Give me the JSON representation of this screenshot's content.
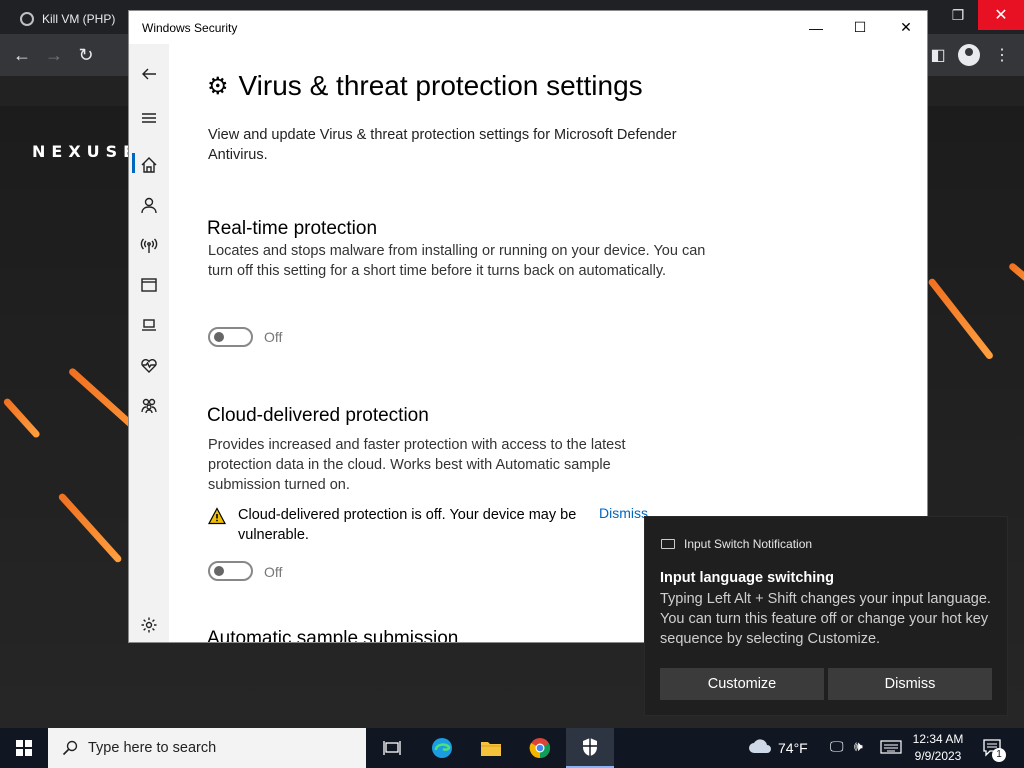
{
  "browser": {
    "tab_title": "Kill VM (PHP)",
    "close_glyph": "✕",
    "restore_glyph": "❐"
  },
  "background": {
    "logo_text": "NEXUSE"
  },
  "window": {
    "title": "Windows Security",
    "minimize_glyph": "—",
    "maximize_glyph": "☐",
    "close_glyph": "✕"
  },
  "page": {
    "title": "Virus & threat protection settings",
    "intro": "View and update Virus & threat protection settings for Microsoft Defender Antivirus.",
    "sections": [
      {
        "heading": "Real-time protection",
        "description": "Locates and stops malware from installing or running on your device. You can turn off this setting for a short time before it turns back on automatically.",
        "toggle_state": "Off"
      },
      {
        "heading": "Cloud-delivered protection",
        "description": "Provides increased and faster protection with access to the latest protection data in the cloud. Works best with Automatic sample submission turned on.",
        "warning": "Cloud-delivered protection is off. Your device may be vulnerable.",
        "warning_link": "Dismiss",
        "toggle_state": "Off"
      },
      {
        "heading": "Automatic sample submission"
      }
    ]
  },
  "notification": {
    "app_name": "Input Switch Notification",
    "title": "Input language switching",
    "body": "Typing Left Alt + Shift changes your input language. You can turn this feature off or change your hot key sequence by selecting Customize.",
    "buttons": [
      "Customize",
      "Dismiss"
    ]
  },
  "taskbar": {
    "search_placeholder": "Type here to search",
    "weather": "74°F",
    "time": "12:34 AM",
    "date": "9/9/2023",
    "notification_count": "1"
  },
  "colors": {
    "accent": "#0067c0",
    "warning": "#f0c000",
    "close_red": "#e81123"
  }
}
